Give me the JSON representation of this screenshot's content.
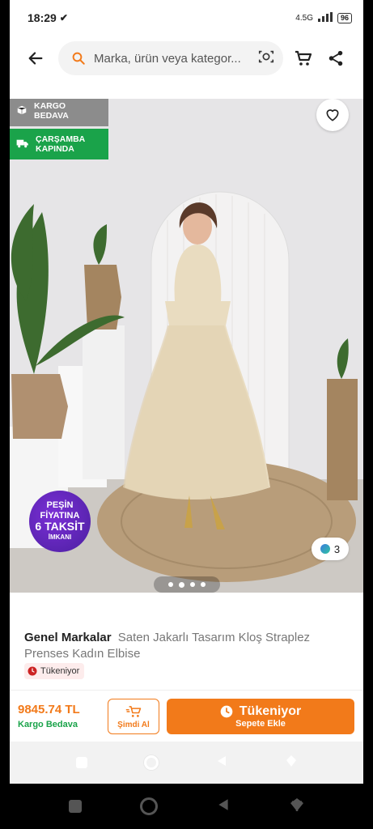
{
  "status_bar": {
    "time": "18:29",
    "network": "4.5G",
    "battery": "96"
  },
  "header": {
    "search_placeholder": "Marka, ürün veya kategor..."
  },
  "product_image": {
    "badge_shipping": "KARGO BEDAVA",
    "badge_delivery": "ÇARŞAMBA KAPINDA",
    "promo_line1": "PEŞİN FİYATINA",
    "promo_line2": "6 TAKSİT",
    "promo_line3": "İMKANI",
    "variant_count": "3",
    "carousel_page_count": 4,
    "carousel_active_index": 1
  },
  "product": {
    "brand": "Genel Markalar",
    "name": "Saten Jakarlı Tasarım Kloş Straplez Prenses Kadın Elbise",
    "stock_status": "Tükeniyor"
  },
  "buy_bar": {
    "price": "9845.74 TL",
    "shipping": "Kargo Bedava",
    "buy_now": "Şimdi Al",
    "main_button_title": "Tükeniyor",
    "main_button_sub": "Sepete Ekle"
  },
  "colors": {
    "accent": "#f27a1a",
    "green": "#1aa34a",
    "badge_gray": "#8c8c8c",
    "promo_purple": "#5a23b8"
  }
}
